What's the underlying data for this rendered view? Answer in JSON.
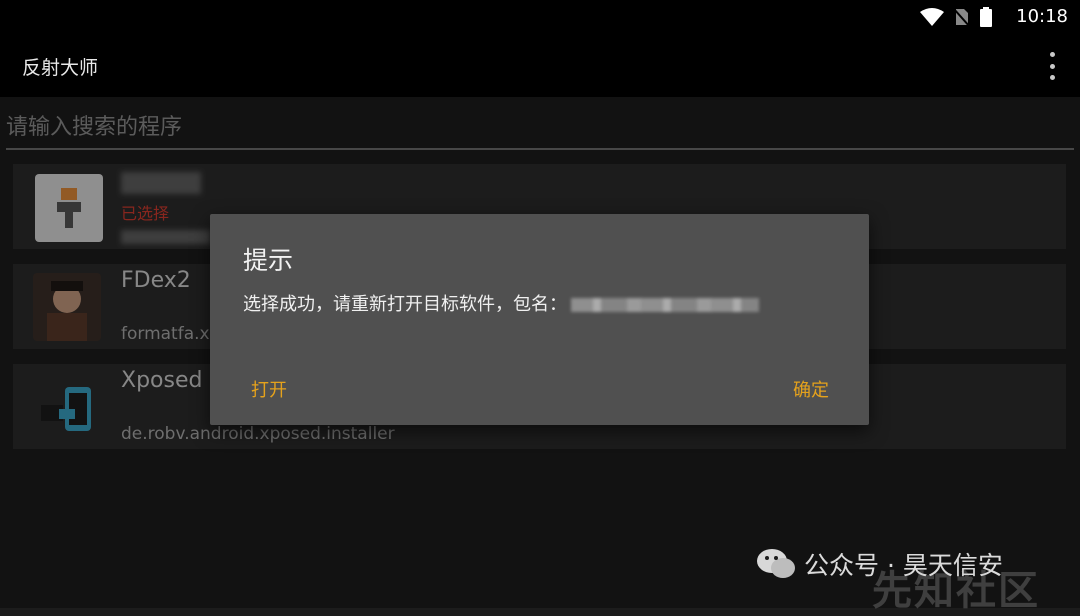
{
  "status": {
    "time": "10:18",
    "icons": [
      "wifi-icon",
      "no-sim-icon",
      "battery-icon"
    ]
  },
  "appbar": {
    "title": "反射大师",
    "menu_icon": "overflow-menu-icon"
  },
  "search": {
    "placeholder": "请输入搜索的程序",
    "value": ""
  },
  "apps": [
    {
      "name": "",
      "status": "已选择",
      "package": ""
    },
    {
      "name": "FDex2",
      "package": "formatfa.x"
    },
    {
      "name": "Xposed",
      "package": "de.robv.android.xposed.installer"
    }
  ],
  "dialog": {
    "title": "提示",
    "message": "选择成功，请重新打开目标软件，包名：",
    "open_label": "打开",
    "ok_label": "确定"
  },
  "watermark": {
    "text": "公众号 · 昊天信安",
    "brand": "先知社区"
  },
  "colors": {
    "accent": "#E5A21C",
    "dialog_bg": "#505050",
    "selected_red": "#D23B2E"
  }
}
